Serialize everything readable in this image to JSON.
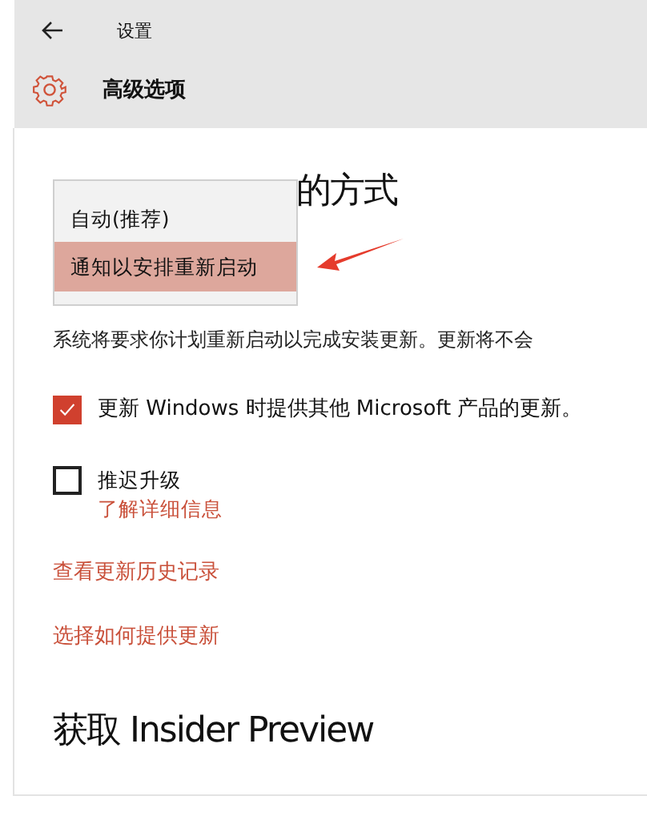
{
  "window": {
    "title": "设置"
  },
  "page": {
    "title": "高级选项"
  },
  "install_section": {
    "heading": "的方式",
    "dropdown_options": [
      {
        "label": "自动(推荐)",
        "selected": false
      },
      {
        "label": "通知以安排重新启动",
        "selected": true
      }
    ],
    "description": "系统将要求你计划重新启动以完成安装更新。更新将不会"
  },
  "checkboxes": [
    {
      "label": "更新 Windows 时提供其他 Microsoft 产品的更新。",
      "checked": true
    },
    {
      "label": "推迟升级",
      "checked": false,
      "link": "了解详细信息"
    }
  ],
  "links": [
    "查看更新历史记录",
    "选择如何提供更新"
  ],
  "insider_heading": "获取 Insider Preview"
}
